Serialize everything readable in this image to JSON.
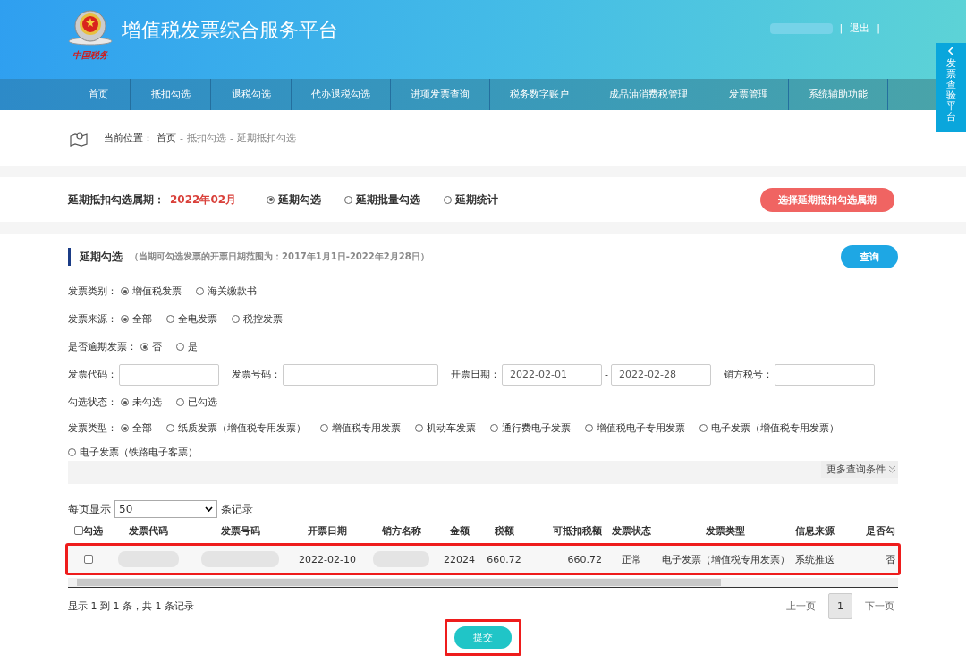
{
  "header": {
    "title": "增值税发票综合服务平台",
    "logo_caption": "中国税务",
    "logout": "退出",
    "separator": "|"
  },
  "nav": [
    {
      "label": "首页",
      "selected": false
    },
    {
      "label": "抵扣勾选",
      "selected": false
    },
    {
      "label": "退税勾选",
      "selected": false
    },
    {
      "label": "代办退税勾选",
      "selected": false
    },
    {
      "label": "进项发票查询",
      "selected": false
    },
    {
      "label": "税务数字账户",
      "selected": false
    },
    {
      "label": "成品油消费税管理",
      "selected": false
    },
    {
      "label": "发票管理",
      "selected": false
    },
    {
      "label": "系统辅助功能",
      "selected": false
    }
  ],
  "side_tab": {
    "label": "发票查验平台"
  },
  "breadcrumb": {
    "prefix": "当前位置：",
    "items": [
      "首页",
      "抵扣勾选",
      "延期抵扣勾选"
    ],
    "separator": "-"
  },
  "period": {
    "label": "延期抵扣勾选属期：",
    "value": "2022年02月",
    "modes": [
      {
        "label": "延期勾选",
        "selected": true
      },
      {
        "label": "延期批量勾选",
        "selected": false
      },
      {
        "label": "延期统计",
        "selected": false
      }
    ],
    "button": "选择延期抵扣勾选属期"
  },
  "section": {
    "title": "延期勾选",
    "note": "（当期可勾选发票的开票日期范围为：2017年1月1日-2022年2月28日）",
    "query_button": "查询"
  },
  "filters": [
    {
      "kind": "radio",
      "label": "发票类别：",
      "options": [
        {
          "label": "增值税发票",
          "selected": true
        },
        {
          "label": "海关缴款书",
          "selected": false
        }
      ]
    },
    {
      "kind": "radio",
      "label": "发票来源：",
      "options": [
        {
          "label": "全部",
          "selected": true
        },
        {
          "label": "全电发票",
          "selected": false
        },
        {
          "label": "税控发票",
          "selected": false
        }
      ]
    },
    {
      "kind": "radio",
      "label": "是否逾期发票：",
      "options": [
        {
          "label": "否",
          "selected": true
        },
        {
          "label": "是",
          "selected": false
        }
      ]
    },
    {
      "kind": "fields",
      "fields": [
        {
          "kind": "single",
          "label": "发票代码："
        },
        {
          "kind": "single",
          "label": "发票号码："
        },
        {
          "kind": "range",
          "label": "开票日期：",
          "from": "2022-02-01",
          "separator": "-",
          "to": "2022-02-28"
        },
        {
          "kind": "single",
          "label": "销方税号："
        }
      ]
    },
    {
      "kind": "radio",
      "label": "勾选状态：",
      "options": [
        {
          "label": "未勾选",
          "selected": true
        },
        {
          "label": "已勾选",
          "selected": false
        }
      ]
    },
    {
      "kind": "radio",
      "label": "发票类型：",
      "options": [
        {
          "label": "全部",
          "selected": true
        },
        {
          "label": "纸质发票（增值税专用发票）",
          "selected": false
        },
        {
          "label": "增值税专用发票",
          "selected": false
        },
        {
          "label": "机动车发票",
          "selected": false
        },
        {
          "label": "通行费电子发票",
          "selected": false
        },
        {
          "label": "增值税电子专用发票",
          "selected": false
        },
        {
          "label": "电子发票（增值税专用发票）",
          "selected": false
        },
        {
          "label": "电子发票（铁路电子客票）",
          "selected": false
        }
      ]
    }
  ],
  "more_conditions": "更多查询条件",
  "page_size": {
    "prefix": "每页显示",
    "value": "50",
    "suffix": "条记录"
  },
  "table": {
    "select_all": {
      "label": "勾选",
      "checked": false
    },
    "columns": [
      "发票代码",
      "发票号码",
      "开票日期",
      "销方名称",
      "金额",
      "税额",
      "可抵扣税额",
      "发票状态",
      "发票类型",
      "信息来源",
      "是否勾"
    ],
    "rows": [
      {
        "checked": false,
        "highlighted": true,
        "cells": [
          {
            "kind": "blurred"
          },
          {
            "kind": "blurred"
          },
          {
            "kind": "text",
            "text": "2022-02-10"
          },
          {
            "kind": "blurred"
          },
          {
            "kind": "text",
            "text": "22024"
          },
          {
            "kind": "text",
            "text": "660.72"
          },
          {
            "kind": "text",
            "text": "660.72"
          },
          {
            "kind": "text",
            "text": "正常"
          },
          {
            "kind": "text",
            "text": "电子发票（增值税专用发票）"
          },
          {
            "kind": "text",
            "text": "系统推送"
          },
          {
            "kind": "text",
            "text": "否"
          }
        ]
      }
    ]
  },
  "summary": "显示 1 到 1 条，共 1 条记录",
  "pagination": {
    "prev": "上一页",
    "pages": [
      {
        "label": "1",
        "selected": true
      }
    ],
    "next": "下一页"
  },
  "submit": {
    "label": "提交",
    "highlighted": true
  }
}
